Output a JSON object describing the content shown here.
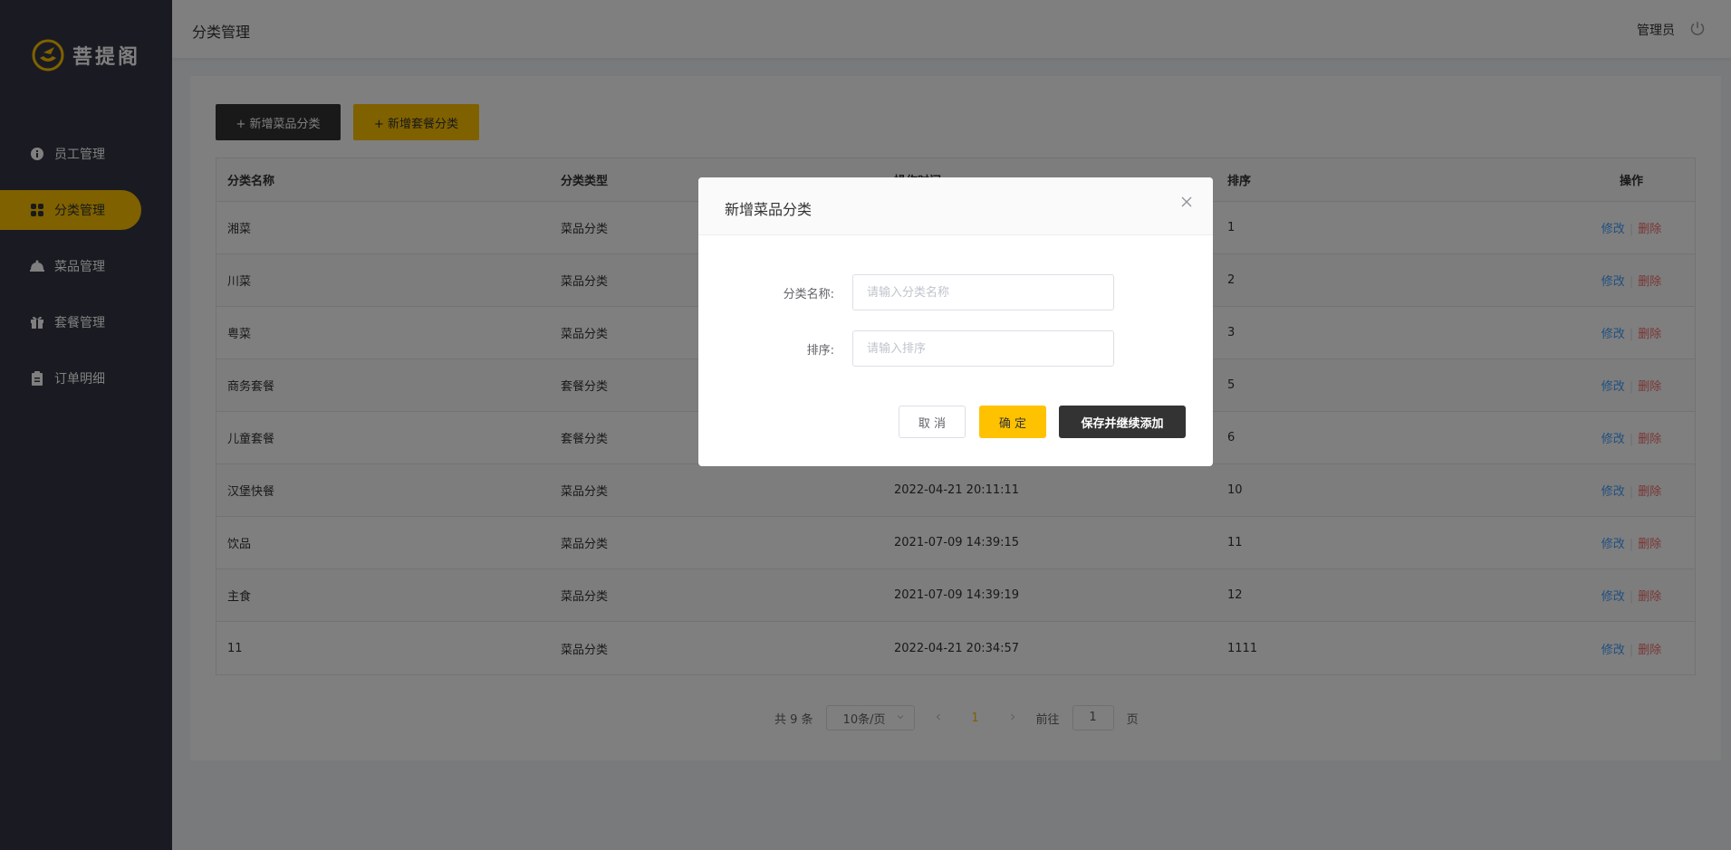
{
  "brand": {
    "name": "菩提阁",
    "color": "#ffc200"
  },
  "sidebar": {
    "items": [
      {
        "label": "员工管理",
        "icon": "info-icon",
        "active": false
      },
      {
        "label": "分类管理",
        "icon": "grid-icon",
        "active": true
      },
      {
        "label": "菜品管理",
        "icon": "cloche-icon",
        "active": false
      },
      {
        "label": "套餐管理",
        "icon": "gift-icon",
        "active": false
      },
      {
        "label": "订单明细",
        "icon": "clipboard-icon",
        "active": false
      }
    ]
  },
  "header": {
    "title": "分类管理",
    "user": "管理员",
    "logout_icon": "power-icon"
  },
  "toolbar": {
    "add_dish_category": "+ 新增菜品分类",
    "add_combo_category": "+ 新增套餐分类"
  },
  "table": {
    "headers": [
      "分类名称",
      "分类类型",
      "操作时间",
      "排序",
      "操作"
    ],
    "rows": [
      {
        "name": "湘菜",
        "type": "菜品分类",
        "time": "",
        "sort": "1"
      },
      {
        "name": "川菜",
        "type": "菜品分类",
        "time": "",
        "sort": "2"
      },
      {
        "name": "粤菜",
        "type": "菜品分类",
        "time": "",
        "sort": "3"
      },
      {
        "name": "商务套餐",
        "type": "套餐分类",
        "time": "",
        "sort": "5"
      },
      {
        "name": "儿童套餐",
        "type": "套餐分类",
        "time": "",
        "sort": "6"
      },
      {
        "name": "汉堡快餐",
        "type": "菜品分类",
        "time": "2022-04-21 20:11:11",
        "sort": "10"
      },
      {
        "name": "饮品",
        "type": "菜品分类",
        "time": "2021-07-09 14:39:15",
        "sort": "11"
      },
      {
        "name": "主食",
        "type": "菜品分类",
        "time": "2021-07-09 14:39:19",
        "sort": "12"
      },
      {
        "name": "11",
        "type": "菜品分类",
        "time": "2022-04-21 20:34:57",
        "sort": "1111"
      }
    ],
    "edit_label": "修改",
    "delete_label": "删除"
  },
  "pagination": {
    "total": "共 9 条",
    "page_size": "10条/页",
    "current": "1",
    "goto_prefix": "前往",
    "goto_value": "1",
    "goto_suffix": "页"
  },
  "dialog": {
    "title": "新增菜品分类",
    "name_label": "分类名称:",
    "name_placeholder": "请输入分类名称",
    "sort_label": "排序:",
    "sort_placeholder": "请输入排序",
    "cancel": "取 消",
    "confirm": "确 定",
    "save_continue": "保存并继续添加"
  }
}
